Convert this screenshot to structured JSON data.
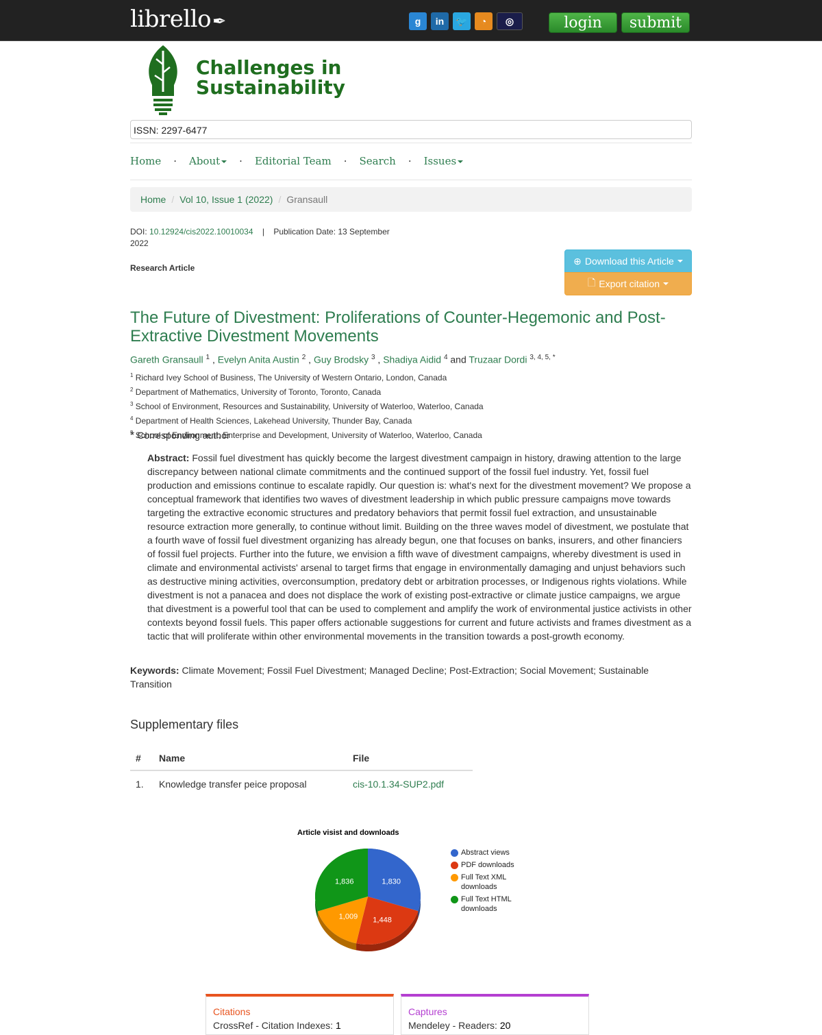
{
  "header": {
    "brand": "librello",
    "login_label": "login",
    "submit_label": "submit",
    "social": [
      "google-icon",
      "linkedin-icon",
      "twitter-icon",
      "rss-icon",
      "cross-icon"
    ]
  },
  "journal": {
    "name_line1": "Challenges in",
    "name_line2": "Sustainability",
    "issn": "ISSN: 2297-6477"
  },
  "nav": {
    "home": "Home",
    "about": "About",
    "editorial": "Editorial Team",
    "search": "Search",
    "issues": "Issues"
  },
  "breadcrumb": {
    "home": "Home",
    "issue": "Vol 10, Issue 1 (2022)",
    "current": "Gransaull"
  },
  "article": {
    "doi_label": "DOI:",
    "doi": "10.12924/cis2022.10010034",
    "sep": "|",
    "pubdate_label": "Publication Date: 13 September 2022",
    "type": "Research Article",
    "download_label": "Download this Article",
    "export_label": "Export citation",
    "title": "The Future of Divestment: Proliferations of Counter-Hegemonic and Post-Extractive Divestment Movements",
    "authors": [
      {
        "name": "Gareth Gransaull",
        "sup": "1"
      },
      {
        "name": "Evelyn Anita Austin",
        "sup": "2"
      },
      {
        "name": "Guy Brodsky",
        "sup": "3"
      },
      {
        "name": "Shadiya Aidid",
        "sup": "4"
      },
      {
        "name": "Truzaar Dordi",
        "sup": "3, 4, 5, *"
      }
    ],
    "and": "and",
    "affiliations": [
      {
        "num": "1",
        "text": "Richard Ivey School of Business, The University of Western Ontario, London, Canada"
      },
      {
        "num": "2",
        "text": "Department of Mathematics, University of Toronto, Toronto, Canada"
      },
      {
        "num": "3",
        "text": "School of Environment, Resources and Sustainability, University of Waterloo, Waterloo, Canada"
      },
      {
        "num": "4",
        "text": "Department of Health Sciences, Lakehead University, Thunder Bay, Canada"
      },
      {
        "num": "5",
        "text": "School of Environment, Enterprise and Development, University of Waterloo, Waterloo, Canada"
      }
    ],
    "corresponding_star": "*",
    "corresponding": "Corresponding author",
    "abstract_label": "Abstract:",
    "abstract": "Fossil fuel divestment has quickly become the largest divestment campaign in history, drawing attention to the large discrepancy between national climate commitments and the continued support of the fossil fuel industry. Yet, fossil fuel production and emissions continue to escalate rapidly. Our question is: what's next for the divestment movement? We propose a conceptual framework that identifies two waves of divestment leadership in which public pressure campaigns move towards targeting the extractive economic structures and predatory behaviors that permit fossil fuel extraction, and unsustainable resource extraction more generally, to continue without limit. Building on the three waves model of divestment, we postulate that a fourth wave of fossil fuel divestment organizing has already begun, one that focuses on banks, insurers, and other financiers of fossil fuel projects. Further into the future, we envision a fifth wave of divestment campaigns, whereby divestment is used in climate and environmental activists' arsenal to target firms that engage in environmentally damaging and unjust behaviors such as destructive mining activities, overconsumption, predatory debt or arbitration processes, or Indigenous rights violations. While divestment is not a panacea and does not displace the work of existing post-extractive or climate justice campaigns, we argue that divestment is a powerful tool that can be used to complement and amplify the work of environmental justice activists in other contexts beyond fossil fuels. This paper offers actionable suggestions for current and future activists and frames divestment as a tactic that will proliferate within other environmental movements in the transition towards a post-growth economy.",
    "keywords_label": "Keywords:",
    "keywords": "Climate Movement; Fossil Fuel Divestment; Managed Decline; Post-Extraction; Social Movement; Sustainable Transition"
  },
  "supplementary": {
    "heading": "Supplementary files",
    "columns": [
      "#",
      "Name",
      "File"
    ],
    "rows": [
      {
        "num": "1.",
        "name": "Knowledge transfer peice proposal",
        "file": "cis-10.1.34-SUP2.pdf"
      }
    ]
  },
  "chart_data": {
    "type": "pie",
    "title": "Article visist and downloads",
    "slices": [
      {
        "label": "Abstract views",
        "value": 1830,
        "display": "1,830",
        "color": "#3366cc"
      },
      {
        "label": "PDF downloads",
        "value": 1448,
        "display": "1,448",
        "color": "#dc3912"
      },
      {
        "label": "Full Text XML downloads",
        "value": 1009,
        "display": "1,009",
        "color": "#ff9900"
      },
      {
        "label": "Full Text HTML downloads",
        "value": 1836,
        "display": "1,836",
        "color": "#109618"
      }
    ],
    "legend_position": "right"
  },
  "metrics": {
    "citations_label": "Citations",
    "citations_row": "CrossRef - Citation Indexes:",
    "citations_value": "1",
    "captures_label": "Captures",
    "captures_row": "Mendeley - Readers:",
    "captures_value": "20"
  }
}
